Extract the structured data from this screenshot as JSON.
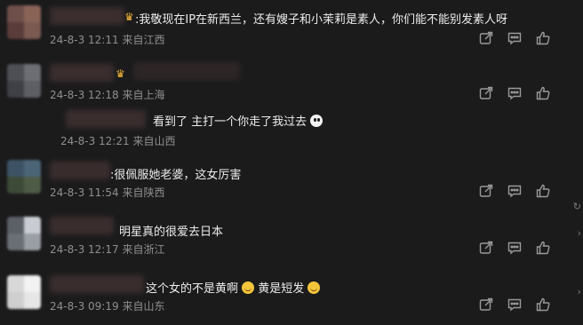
{
  "comments": [
    {
      "text": ":我敬现在IP在新西兰，还有嫂子和小茉莉是素人，你们能不能别发素人呀",
      "date": "24-8-3 12:11",
      "location": "来自江西",
      "has_crown": true
    },
    {
      "text": "",
      "date": "24-8-3 12:18",
      "location": "来自上海",
      "has_crown": true
    },
    {
      "text": "看到了 主打一个你走了我过去",
      "date": "24-8-3 12:21",
      "location": "来自山西",
      "is_reply": true,
      "emoji": "ghost-emoji"
    },
    {
      "text": ":很佩服她老婆，这女厉害",
      "date": "24-8-3 11:54",
      "location": "来自陕西"
    },
    {
      "text": "明星真的很爱去日本",
      "date": "24-8-3 12:17",
      "location": "来自浙江"
    },
    {
      "text_part1": "这个女的不是黄啊",
      "text_part2": " 黄是短发",
      "date": "24-8-3 09:19",
      "location": "来自山东",
      "emoji": "grin-emoji"
    }
  ],
  "icons": {
    "share": "share-icon",
    "comment": "comment-icon",
    "like": "thumbs-up-icon"
  },
  "colors": {
    "background": "#1b1b1c",
    "text": "#ececec",
    "meta": "#8f8f8f",
    "crown": "#f2b63a"
  }
}
